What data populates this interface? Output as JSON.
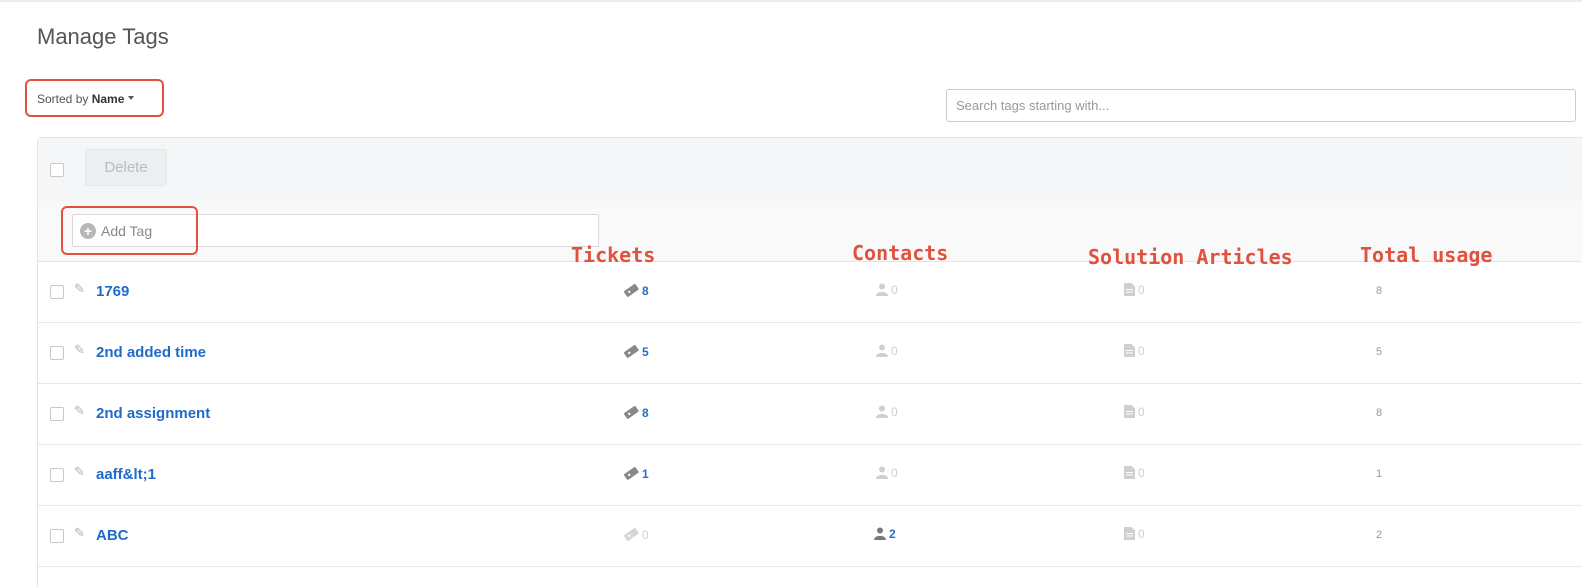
{
  "page": {
    "title": "Manage Tags"
  },
  "sort": {
    "prefix": "Sorted by",
    "value": "Name"
  },
  "search": {
    "placeholder": "Search tags starting with..."
  },
  "toolbar": {
    "delete_label": "Delete"
  },
  "add_tag": {
    "placeholder": "Add Tag"
  },
  "annotations": {
    "tickets": "Tickets",
    "contacts": "Contacts",
    "solution_articles": "Solution Articles",
    "total_usage": "Total usage"
  },
  "rows": [
    {
      "name": "1769",
      "tickets": "8",
      "contacts": "0",
      "articles": "0",
      "total": "8"
    },
    {
      "name": "2nd added time",
      "tickets": "5",
      "contacts": "0",
      "articles": "0",
      "total": "5"
    },
    {
      "name": "2nd assignment",
      "tickets": "8",
      "contacts": "0",
      "articles": "0",
      "total": "8"
    },
    {
      "name": "aaff&lt;1",
      "tickets": "1",
      "contacts": "0",
      "articles": "0",
      "total": "1"
    },
    {
      "name": "ABC",
      "tickets": "0",
      "contacts": "2",
      "articles": "0",
      "total": "2"
    }
  ],
  "colors": {
    "link": "#1f6bc9",
    "annotation": "#e0523f"
  }
}
